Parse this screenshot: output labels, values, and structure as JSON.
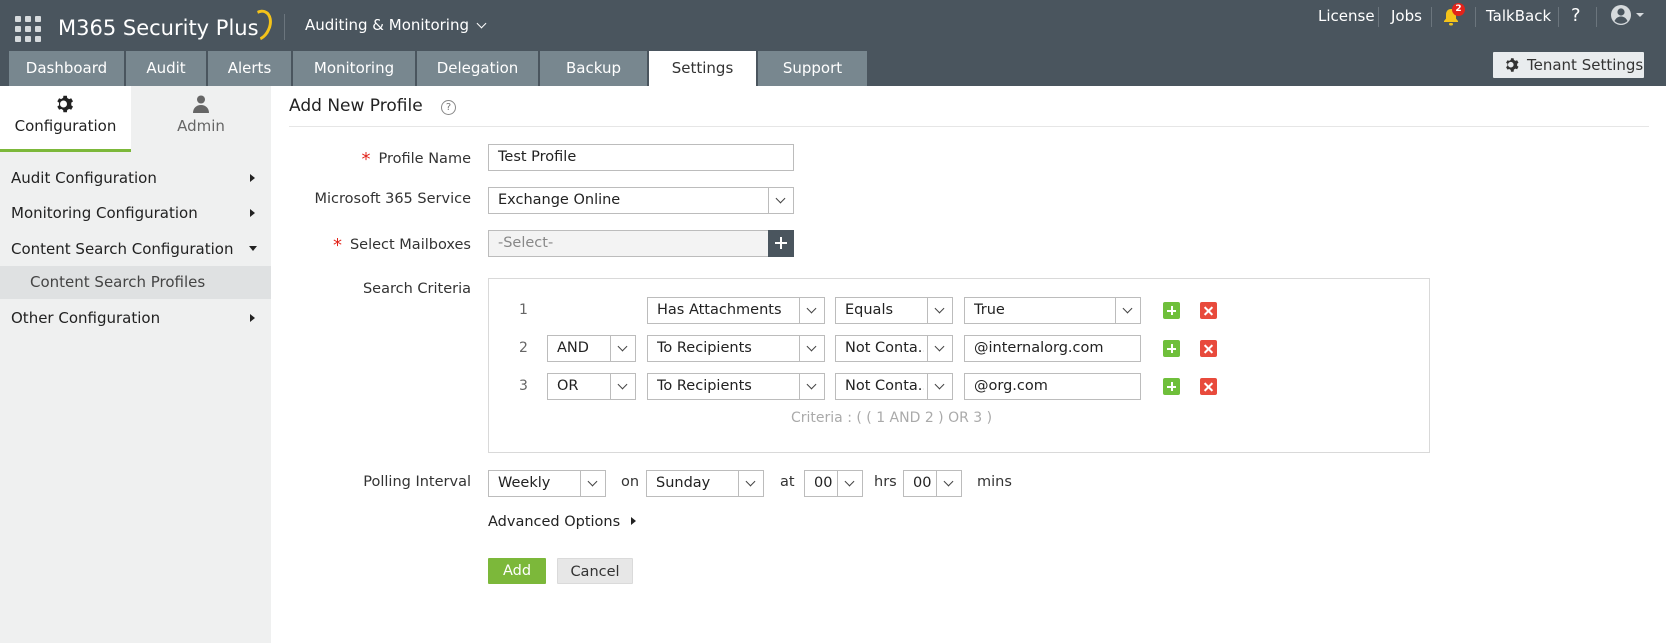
{
  "header": {
    "app_name": "M365 Security Plus",
    "product_menu": "Auditing & Monitoring",
    "links": {
      "license": "License",
      "jobs": "Jobs",
      "talkback": "TalkBack",
      "help": "?"
    },
    "notification_count": "2"
  },
  "tabs": [
    {
      "label": "Dashboard",
      "active": false
    },
    {
      "label": "Audit",
      "active": false
    },
    {
      "label": "Alerts",
      "active": false
    },
    {
      "label": "Monitoring",
      "active": false
    },
    {
      "label": "Delegation",
      "active": false
    },
    {
      "label": "Backup",
      "active": false
    },
    {
      "label": "Settings",
      "active": true
    },
    {
      "label": "Support",
      "active": false
    }
  ],
  "tenant_settings": "Tenant Settings",
  "sidebar": {
    "tabs": [
      {
        "label": "Configuration",
        "icon": "gear-icon",
        "active": true
      },
      {
        "label": "Admin",
        "icon": "user-icon",
        "active": false
      }
    ],
    "items": [
      {
        "label": "Audit Configuration",
        "expanded": false
      },
      {
        "label": "Monitoring Configuration",
        "expanded": false
      },
      {
        "label": "Content Search Configuration",
        "expanded": true
      },
      {
        "label": "Content Search Profiles",
        "selected": true
      },
      {
        "label": "Other Configuration",
        "expanded": false
      }
    ]
  },
  "form": {
    "title": "Add New Profile",
    "help_icon": "?",
    "profile_name": {
      "label": "Profile Name",
      "value": "Test Profile"
    },
    "service": {
      "label": "Microsoft 365 Service",
      "value": "Exchange Online"
    },
    "mailboxes": {
      "label": "Select Mailboxes",
      "placeholder": "-Select-"
    },
    "search_criteria": {
      "label": "Search Criteria",
      "rows": [
        {
          "num": "1",
          "logic": "",
          "field": "Has Attachments",
          "operator": "Equals",
          "value": "True",
          "value_is_select": true
        },
        {
          "num": "2",
          "logic": "AND",
          "field": "To Recipients",
          "operator": "Not Conta...",
          "value": "@internalorg.com",
          "value_is_select": false
        },
        {
          "num": "3",
          "logic": "OR",
          "field": "To Recipients",
          "operator": "Not Conta...",
          "value": "@org.com",
          "value_is_select": false
        }
      ],
      "expression": "Criteria : ( ( 1 AND 2 ) OR 3 )"
    },
    "polling": {
      "label": "Polling Interval",
      "frequency": "Weekly",
      "on_label": "on",
      "day": "Sunday",
      "at_label": "at",
      "hours": "00",
      "hrs_label": "hrs",
      "minutes": "00",
      "mins_label": "mins"
    },
    "advanced": "Advanced Options",
    "add_button": "Add",
    "cancel_button": "Cancel"
  },
  "colors": {
    "header_bg": "#4a555e",
    "tab_bg": "#78878f",
    "accent_green": "#7cb83a",
    "delete_red": "#e84a3c"
  }
}
